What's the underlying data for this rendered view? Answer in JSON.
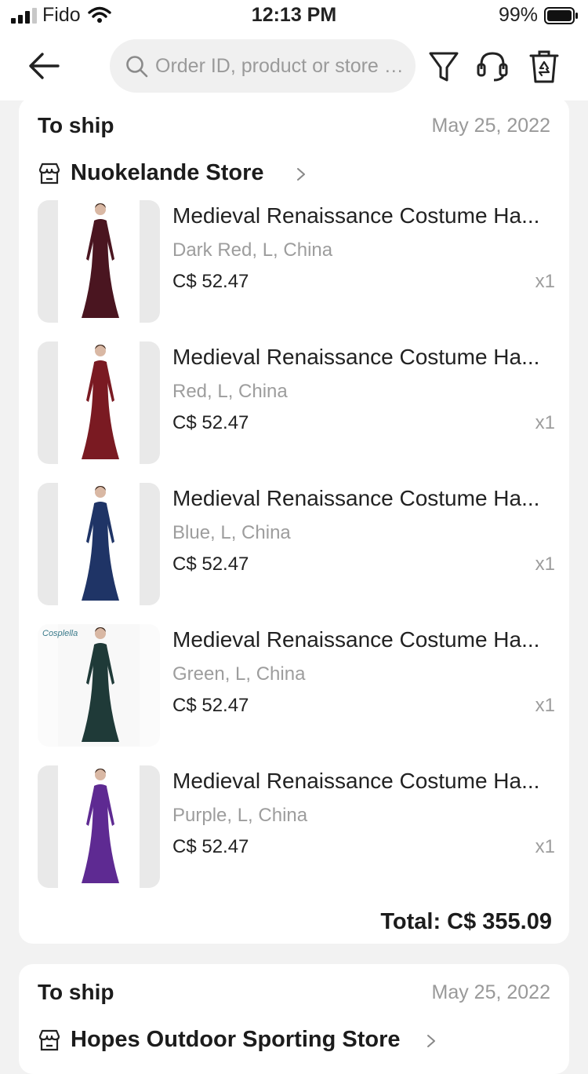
{
  "status_bar": {
    "carrier": "Fido",
    "time": "12:13 PM",
    "battery": "99%"
  },
  "header": {
    "search_placeholder": "Order ID, product or store n..."
  },
  "orders": [
    {
      "status": "To ship",
      "date": "May 25, 2022",
      "store": "Nuokelande Store",
      "items": [
        {
          "title": "Medieval Renaissance Costume Ha...",
          "variant": "Dark Red, L, China",
          "price": "C$ 52.47",
          "qty": "x1",
          "color": "#4a1520"
        },
        {
          "title": "Medieval Renaissance Costume Ha...",
          "variant": "Red, L, China",
          "price": "C$ 52.47",
          "qty": "x1",
          "color": "#7a1a22"
        },
        {
          "title": "Medieval Renaissance Costume Ha...",
          "variant": "Blue, L, China",
          "price": "C$ 52.47",
          "qty": "x1",
          "color": "#1f3466"
        },
        {
          "title": "Medieval Renaissance Costume Ha...",
          "variant": "Green, L, China",
          "price": "C$ 52.47",
          "qty": "x1",
          "color": "#1f3a38"
        },
        {
          "title": "Medieval Renaissance Costume Ha...",
          "variant": "Purple, L, China",
          "price": "C$ 52.47",
          "qty": "x1",
          "color": "#5e2a92"
        }
      ],
      "total": "Total: C$ 355.09"
    },
    {
      "status": "To ship",
      "date": "May 25, 2022",
      "store": "Hopes Outdoor Sporting Store"
    }
  ],
  "logo_text": "Cosplella"
}
